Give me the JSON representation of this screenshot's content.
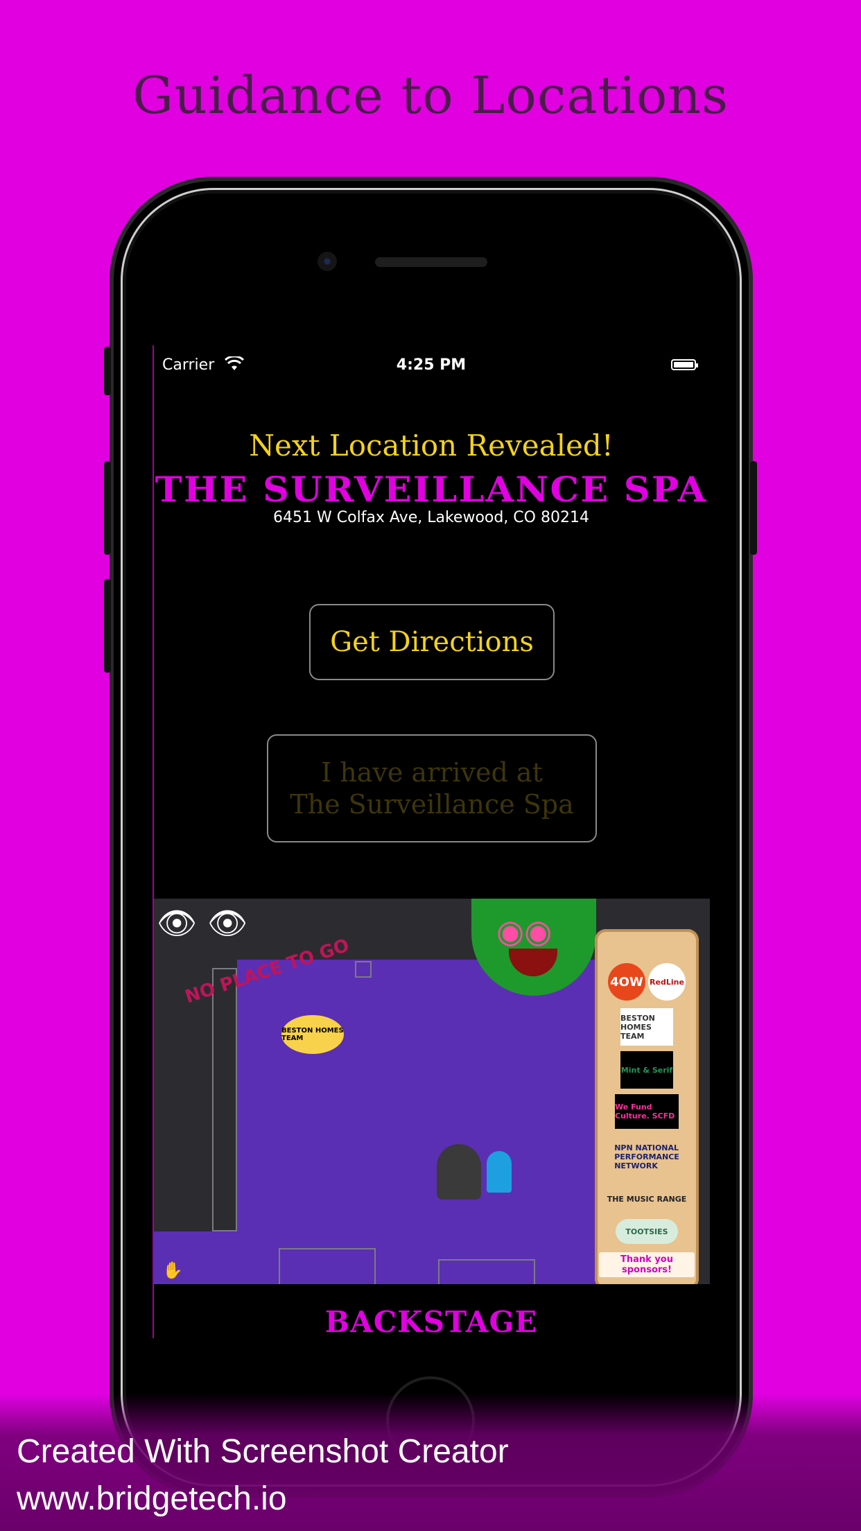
{
  "headline": "Guidance to Locations",
  "status_bar": {
    "carrier": "Carrier",
    "time": "4:25 PM"
  },
  "screen": {
    "next_label": "Next Location Revealed!",
    "location_name": "THE SURVEILLANCE SPA",
    "address": "6451 W Colfax Ave, Lakewood, CO 80214",
    "directions_button": "Get Directions",
    "arrived_button": {
      "line1": "I have arrived at",
      "line2": "The Surveillance Spa"
    },
    "map": {
      "deco_text": "NO PLACE TO GO",
      "sponsors": [
        "4OW",
        "RedLine",
        "BESTON HOMES TEAM",
        "Mint & Serif",
        "We Fund Culture. SCFD",
        "NPN NATIONAL PERFORMANCE NETWORK",
        "THE MUSIC RANGE",
        "TOOTSIES"
      ],
      "sponsors_thanks": "Thank you sponsors!",
      "badge": "BESTON HOMES TEAM"
    },
    "footer_label": "BACKSTAGE"
  },
  "credit": {
    "line1": "Created With Screenshot Creator",
    "line2": "www.bridgetech.io"
  },
  "colors": {
    "background": "#e000e0",
    "headline": "#4a1b4a",
    "accent_yellow": "#f4d21c",
    "accent_magenta": "#e000e0",
    "map_floor": "#5b2fb3"
  }
}
